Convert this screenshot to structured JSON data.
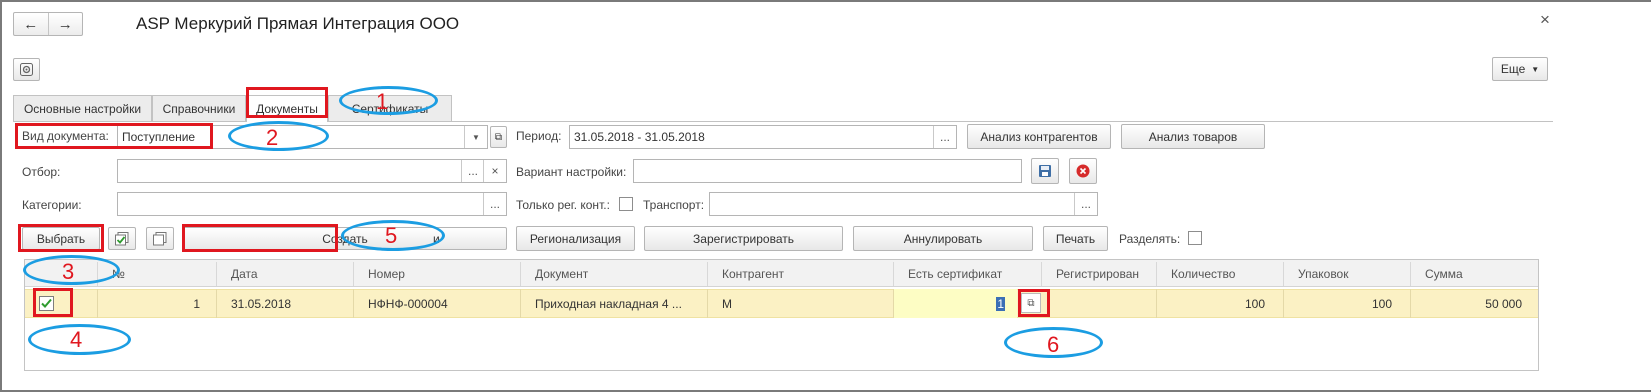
{
  "window": {
    "title": "ASP Меркурий Прямая Интеграция ООО",
    "back": "←",
    "forward": "→",
    "close": "×"
  },
  "toolbar": {
    "more_label": "Еще"
  },
  "tabs": [
    {
      "label": "Основные настройки"
    },
    {
      "label": "Справочники"
    },
    {
      "label": "Документы"
    },
    {
      "label": "Сертификаты"
    }
  ],
  "filters": {
    "doc_type_label": "Вид документа:",
    "doc_type_value": "Поступление",
    "period_label": "Период:",
    "period_value": "31.05.2018 - 31.05.2018",
    "analyze_contractors": "Анализ контрагентов",
    "analyze_goods": "Анализ товаров",
    "filter_label": "Отбор:",
    "setting_variant_label": "Вариант настройки:",
    "categories_label": "Категории:",
    "only_reg_label": "Только рег. конт.:",
    "transport_label": "Транспорт:",
    "ellipsis": "...",
    "clear": "×"
  },
  "actions": {
    "select": "Выбрать",
    "create": "Создать",
    "hidden_tail": "и",
    "regionalization": "Регионализация",
    "register": "Зарегистрировать",
    "cancel": "Аннулировать",
    "print": "Печать",
    "split_label": "Разделять:"
  },
  "table": {
    "columns": [
      "№",
      "Дата",
      "Номер",
      "Документ",
      "Контрагент",
      "Есть сертификат",
      "Регистрирован",
      "Количество",
      "Упаковок",
      "Сумма"
    ],
    "rows": [
      {
        "checked": true,
        "n": "1",
        "date": "31.05.2018",
        "number": "НФНФ-000004",
        "document": "Приходная накладная 4 ...",
        "contractor": "М",
        "certificate": "1",
        "registered": "",
        "quantity": "100",
        "packages": "100",
        "sum": "50 000"
      }
    ]
  },
  "annotations": [
    "1",
    "2",
    "3",
    "4",
    "5",
    "6"
  ],
  "colors": {
    "highlight_red": "#e0171f",
    "annotation_blue": "#1b9de2",
    "row_selected": "#fbf1c4",
    "cell_active": "#fdfdc4"
  }
}
